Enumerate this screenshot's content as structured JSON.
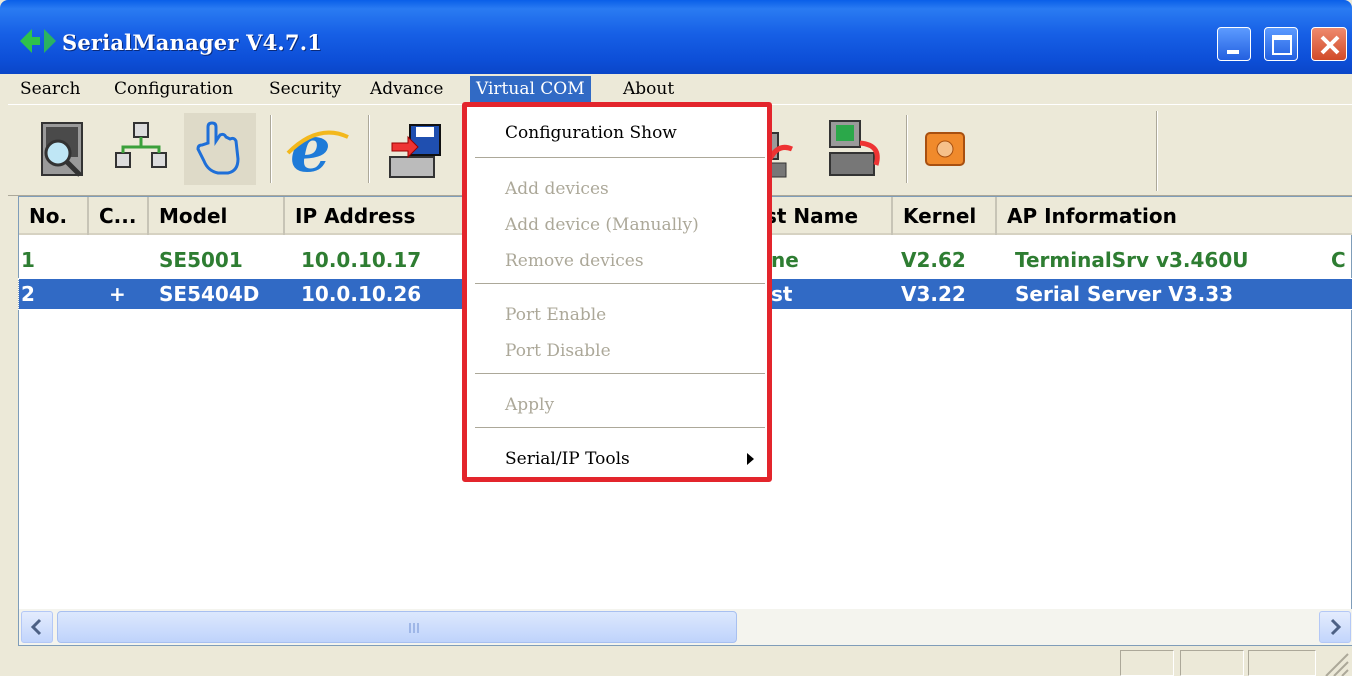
{
  "window": {
    "title": "SerialManager V4.7.1"
  },
  "menubar": {
    "items": [
      {
        "label": "Search",
        "mnemonic": "S"
      },
      {
        "label": "Configuration",
        "mnemonic": "C"
      },
      {
        "label": "Security",
        "mnemonic": "e"
      },
      {
        "label": "Advance",
        "mnemonic": "A"
      },
      {
        "label": "Virtual COM",
        "mnemonic": "i"
      },
      {
        "label": "About",
        "mnemonic": "b"
      }
    ],
    "active": "Virtual COM"
  },
  "toolbar": {
    "icons": [
      "search-device-icon",
      "network-icon",
      "hand-pointer-icon",
      "internet-explorer-icon",
      "save-to-device-icon",
      "com-connect-icon",
      "com-disconnect-icon",
      "telephone-icon"
    ]
  },
  "list": {
    "columns": [
      "No.",
      "C...",
      "Model",
      "IP Address",
      "",
      "st Name",
      "Kernel",
      "AP Information"
    ],
    "rows": [
      {
        "no": "1",
        "c": "",
        "model": "SE5001",
        "ip": "10.0.10.17",
        "host": "ne",
        "kernel": "V2.62",
        "ap": "TerminalSrv v3.460U",
        "extra": "C",
        "selected": false
      },
      {
        "no": "2",
        "c": "+",
        "model": "SE5404D",
        "ip": "10.0.10.26",
        "host": "st",
        "kernel": "V3.22",
        "ap": "Serial Server V3.33",
        "extra": "",
        "selected": true
      }
    ]
  },
  "dropdown": {
    "items": [
      {
        "label": "Configuration Show",
        "enabled": true
      },
      {
        "label": "Add devices",
        "enabled": false
      },
      {
        "label": "Add device (Manually)",
        "enabled": false
      },
      {
        "label": "Remove devices",
        "enabled": false
      },
      {
        "label": "Port Enable",
        "enabled": false
      },
      {
        "label": "Port Disable",
        "enabled": false
      },
      {
        "label": "Apply",
        "enabled": false
      },
      {
        "label": "Serial/IP Tools",
        "enabled": true,
        "submenu": true
      }
    ]
  },
  "colors": {
    "titlebar": "#0A5FE8",
    "selection": "#316AC5",
    "row_text": "#2E7D32",
    "highlight_border": "#E3252C"
  }
}
